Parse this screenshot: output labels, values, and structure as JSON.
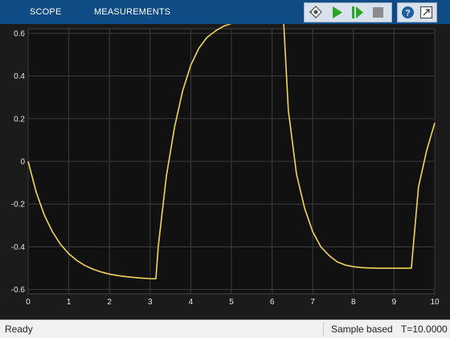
{
  "toolbar": {
    "tabs": [
      "SCOPE",
      "MEASUREMENTS"
    ],
    "buttons": [
      "highlight-simulink-block-icon",
      "run-icon",
      "step-forward-icon",
      "stop-icon",
      "help-icon",
      "undock-icon"
    ],
    "colors": {
      "bar": "#0f4c86",
      "run": "#2aa52a",
      "stop": "#8c8c8c"
    }
  },
  "status": {
    "ready": "Ready",
    "mode": "Sample based",
    "time": "T=10.0000"
  },
  "chart_data": {
    "type": "line",
    "xlim": [
      0,
      10
    ],
    "ylim": [
      -0.62,
      0.62
    ],
    "x_ticks": [
      "0",
      "1",
      "2",
      "3",
      "4",
      "5",
      "6",
      "7",
      "8",
      "9",
      "10"
    ],
    "y_ticks": [
      "-0.6",
      "-0.4",
      "-0.2",
      "0",
      "0.2",
      "0.4",
      "0.6"
    ],
    "grid": true,
    "colors": {
      "line": "#f3d55b",
      "background": "#111111",
      "grid": "#3c3c3c"
    },
    "series": [
      {
        "x": [
          0,
          0.2,
          0.4,
          0.6,
          0.8,
          1.0,
          1.2,
          1.4,
          1.6,
          1.8,
          2.0,
          2.2,
          2.4,
          2.6,
          2.8,
          3.0,
          3.1416,
          3.2,
          3.4,
          3.6,
          3.8,
          4.0,
          4.2,
          4.4,
          4.6,
          4.8,
          5.0,
          5.2,
          5.4,
          5.6,
          5.8,
          6.0,
          6.2832,
          6.4,
          6.6,
          6.8,
          7.0,
          7.2,
          7.4,
          7.6,
          7.8,
          8.0,
          8.2,
          8.4,
          8.6,
          8.8,
          9.0,
          9.2,
          9.4248,
          9.6,
          9.8,
          10.0
        ],
        "y": [
          0,
          -0.1448,
          -0.2518,
          -0.3308,
          -0.3892,
          -0.4323,
          -0.4641,
          -0.4877,
          -0.5051,
          -0.518,
          -0.5275,
          -0.5345,
          -0.5397,
          -0.5435,
          -0.5464,
          -0.5485,
          -0.5495,
          -0.4,
          -0.07,
          0.16,
          0.33,
          0.45,
          0.53,
          0.58,
          0.61,
          0.632,
          0.645,
          0.652,
          0.656,
          0.658,
          0.659,
          0.66,
          0.66,
          0.24,
          -0.06,
          -0.22,
          -0.33,
          -0.4,
          -0.44,
          -0.47,
          -0.485,
          -0.493,
          -0.497,
          -0.499,
          -0.5,
          -0.5,
          -0.5,
          -0.5,
          -0.5,
          -0.12,
          0.05,
          0.18
        ]
      }
    ]
  }
}
